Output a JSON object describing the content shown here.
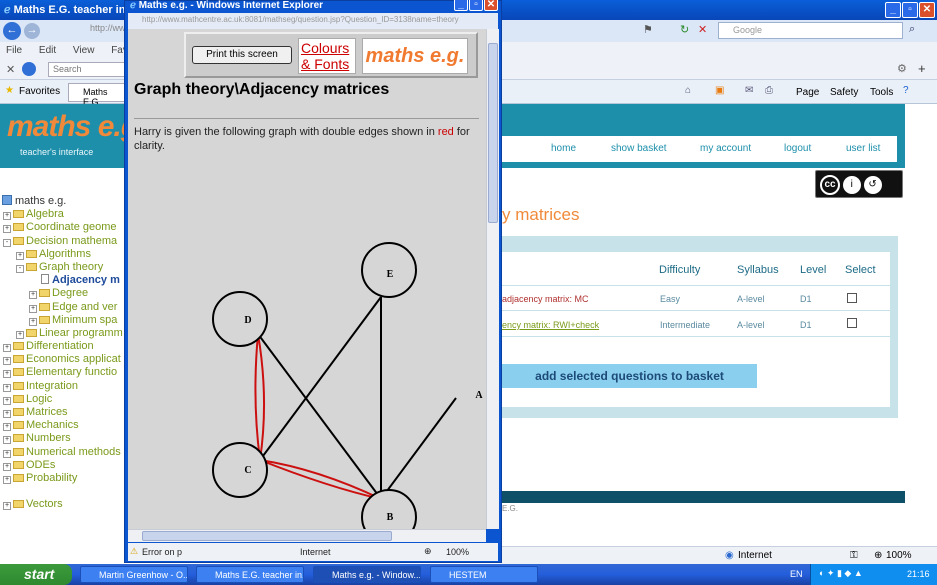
{
  "background_window": {
    "title": "Maths E.G. teacher inte",
    "address_partial": "http://ww",
    "search_engine": "Google",
    "menu": [
      "File",
      "Edit",
      "View",
      "Favorites"
    ],
    "search_placeholder": "Search",
    "favorites_label": "Favorites",
    "tab_label": "Maths E.G.",
    "command_bar": [
      "Page",
      "Safety",
      "Tools"
    ],
    "status_zone": "Internet",
    "zoom_level": "100%"
  },
  "site": {
    "logo": "maths e.g.",
    "logo_sub": "teacher's interface",
    "nav": [
      "home",
      "show basket",
      "my account",
      "logout",
      "user list"
    ],
    "license": "CC BY SA",
    "section_title": "y matrices",
    "tree": [
      {
        "label": "maths e.g.",
        "level": 0,
        "type": "root"
      },
      {
        "label": "Algebra",
        "level": 0,
        "type": "folder",
        "expander": "+"
      },
      {
        "label": "Coordinate geome",
        "level": 0,
        "type": "folder",
        "expander": "+"
      },
      {
        "label": "Decision mathema",
        "level": 0,
        "type": "folder",
        "expander": "-"
      },
      {
        "label": "Algorithms",
        "level": 1,
        "type": "folder",
        "expander": "+"
      },
      {
        "label": "Graph theory",
        "level": 1,
        "type": "folder",
        "expander": "-"
      },
      {
        "label": "Adjacency m",
        "level": 2,
        "type": "page",
        "selected": true
      },
      {
        "label": "Degree",
        "level": 2,
        "type": "folder",
        "expander": "+"
      },
      {
        "label": "Edge and ver",
        "level": 2,
        "type": "folder",
        "expander": "+"
      },
      {
        "label": "Minimum spa",
        "level": 2,
        "type": "folder",
        "expander": "+"
      },
      {
        "label": "Linear programm",
        "level": 1,
        "type": "folder",
        "expander": "+"
      },
      {
        "label": "Differentiation",
        "level": 0,
        "type": "folder",
        "expander": "+"
      },
      {
        "label": "Economics applicat",
        "level": 0,
        "type": "folder",
        "expander": "+"
      },
      {
        "label": "Elementary functio",
        "level": 0,
        "type": "folder",
        "expander": "+"
      },
      {
        "label": "Integration",
        "level": 0,
        "type": "folder",
        "expander": "+"
      },
      {
        "label": "Logic",
        "level": 0,
        "type": "folder",
        "expander": "+"
      },
      {
        "label": "Matrices",
        "level": 0,
        "type": "folder",
        "expander": "+"
      },
      {
        "label": "Mechanics",
        "level": 0,
        "type": "folder",
        "expander": "+"
      },
      {
        "label": "Numbers",
        "level": 0,
        "type": "folder",
        "expander": "+"
      },
      {
        "label": "Numerical methods",
        "level": 0,
        "type": "folder",
        "expander": "+"
      },
      {
        "label": "ODEs",
        "level": 0,
        "type": "folder",
        "expander": "+"
      },
      {
        "label": "Probability",
        "level": 0,
        "type": "folder",
        "expander": "+"
      },
      {
        "label": "Vectors",
        "level": 0,
        "type": "folder",
        "expander": "+"
      }
    ],
    "table": {
      "headers": [
        "Difficulty",
        "Syllabus",
        "Level",
        "Select"
      ],
      "rows": [
        {
          "question": "adjacency matrix: MC",
          "difficulty": "Easy",
          "syllabus": "A-level",
          "level": "D1"
        },
        {
          "question": "ency matrix: RWI+check",
          "difficulty": "Intermediate",
          "syllabus": "A-level",
          "level": "D1"
        }
      ],
      "add_button": "add selected questions to basket"
    },
    "footer_text": "E.G."
  },
  "popup": {
    "title": "Maths e.g. - Windows Internet Explorer",
    "address": "http://www.mathcentre.ac.uk:8081/mathseg/question.jsp?Question_ID=3138name=theory",
    "print_button": "Print this screen",
    "colours_link_1": "Colours",
    "colours_link_2": "& Fonts",
    "logo": "maths e.g.",
    "heading": "Graph theory\\Adjacency matrices",
    "intro_before": "Harry is given the following graph with double edges shown in ",
    "intro_red": "red",
    "intro_after": " for clarity.",
    "nodes": [
      "E",
      "D",
      "A",
      "C",
      "B"
    ],
    "status_text": "Error on p",
    "status_zone": "Internet",
    "zoom_level": "100%"
  },
  "taskbar": {
    "start": "start",
    "tasks": [
      "Martin Greenhow - O...",
      "Maths E.G. teacher in...",
      "Maths e.g. - Window...",
      "HESTEM"
    ],
    "language": "EN",
    "clock": "21:16"
  }
}
